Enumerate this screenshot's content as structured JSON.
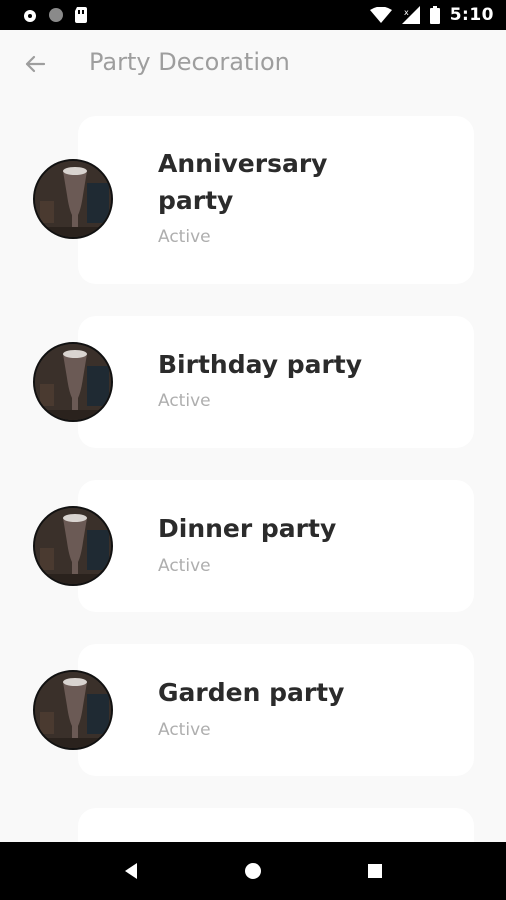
{
  "status_bar": {
    "time": "5:10",
    "icons": [
      "alarm-icon",
      "circle-icon",
      "sim-card-icon",
      "wifi-icon",
      "signal-icon",
      "battery-icon"
    ]
  },
  "app_bar": {
    "back_icon": "arrow-left-icon",
    "title": "Party Decoration"
  },
  "items": [
    {
      "title": "Anniversary party",
      "status": "Active",
      "image": "drink-glass-photo"
    },
    {
      "title": "Birthday party",
      "status": "Active",
      "image": "drink-glass-photo"
    },
    {
      "title": "Dinner party",
      "status": "Active",
      "image": "drink-glass-photo"
    },
    {
      "title": "Garden party",
      "status": "Active",
      "image": "drink-glass-photo"
    }
  ],
  "nav_bar": {
    "icons": [
      "back-triangle-icon",
      "home-circle-icon",
      "recents-square-icon"
    ]
  },
  "colors": {
    "background": "#f9f9f9",
    "card": "#ffffff",
    "title_text": "#2b2b2b",
    "status_text": "#aeaeae",
    "header_text": "#9e9e9e"
  }
}
